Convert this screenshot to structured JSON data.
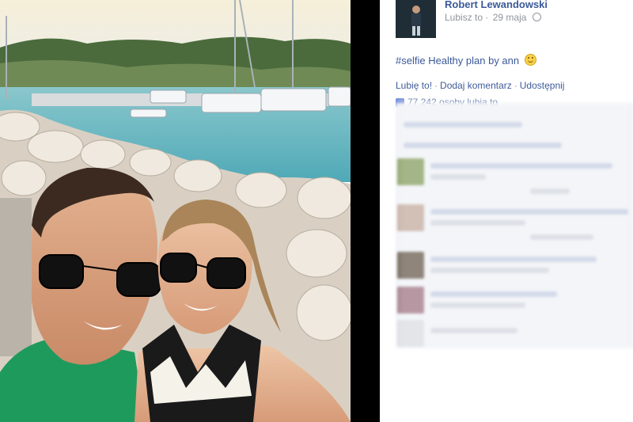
{
  "post": {
    "author": "Robert Lewandowski",
    "page_type": "Lubisz to",
    "date": "29 maja",
    "caption_hashtag": "#selfie",
    "caption_text": "Healthy plan by ann",
    "actions": {
      "like": "Lubię to!",
      "comment": "Dodaj komentarz",
      "share": "Udostępnij"
    },
    "likes_text": "77 242 osoby lubią to"
  },
  "icons": {
    "privacy": "globe-icon",
    "emoji": "smiley-icon",
    "like": "thumbs-up-icon"
  },
  "colors": {
    "link": "#3b5998",
    "meta": "#90949c",
    "divider": "#000000"
  }
}
